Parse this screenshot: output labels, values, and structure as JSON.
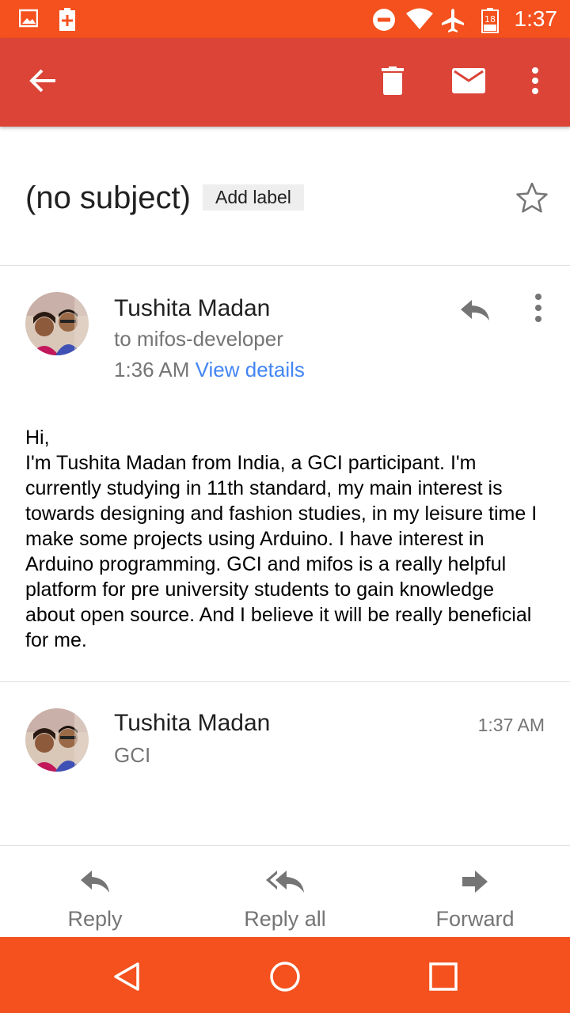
{
  "status_bar": {
    "time": "1:37",
    "battery_level": "18",
    "icons": [
      "image-icon",
      "battery-plus-icon",
      "do-not-disturb-icon",
      "wifi-icon",
      "airplane-icon",
      "battery-icon"
    ]
  },
  "toolbar": {
    "back_icon": "arrow-back-icon",
    "delete_icon": "trash-icon",
    "mark_unread_icon": "mail-icon",
    "more_icon": "more-vert-icon",
    "color": "#db4437"
  },
  "thread": {
    "subject": "(no subject)",
    "add_label": "Add label"
  },
  "messages": [
    {
      "sender": "Tushita Madan",
      "recipient": "to mifos-developer",
      "time": "1:36 AM",
      "view_details": "View details",
      "body": "Hi,\nI'm Tushita Madan from India, a GCI participant. I'm currently studying in 11th standard, my main interest is towards designing and fashion studies, in my leisure time I make some projects using Arduino. I have interest in Arduino programming. GCI and mifos is a really helpful platform for pre university students to gain knowledge about open source. And I believe it will be really beneficial for me."
    },
    {
      "sender": "Tushita Madan",
      "snippet": "GCI",
      "time": "1:37 AM"
    }
  ],
  "actions": {
    "reply": "Reply",
    "reply_all": "Reply all",
    "forward": "Forward"
  },
  "colors": {
    "status_bar": "#f4511e",
    "toolbar": "#db4437",
    "link": "#4285f4",
    "nav_bar": "#f4511e"
  }
}
